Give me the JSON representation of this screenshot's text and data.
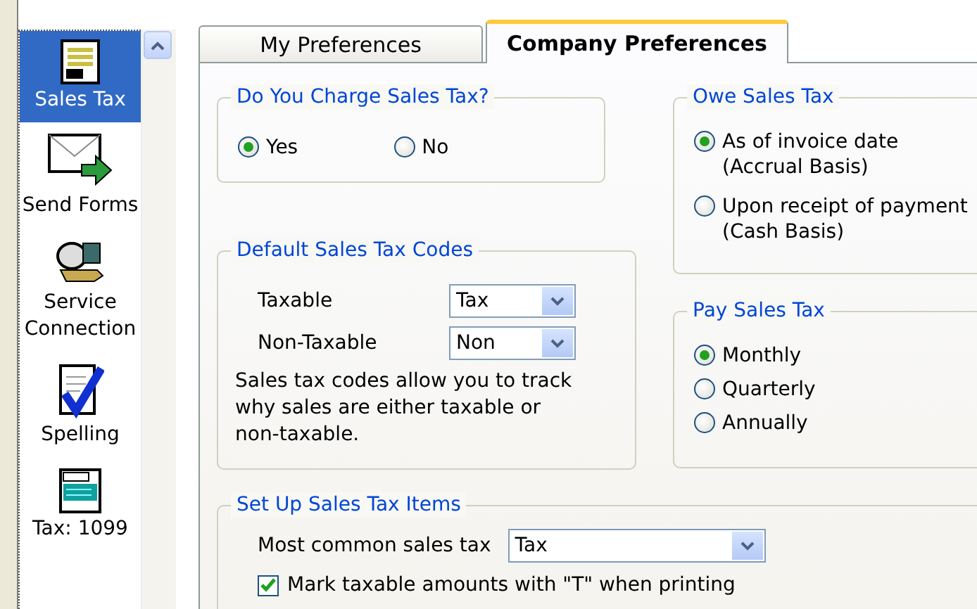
{
  "sidebar": {
    "items": [
      {
        "label": "Sales Tax",
        "selected": true
      },
      {
        "label": "Send Forms",
        "selected": false
      },
      {
        "label": "Service Connection",
        "selected": false
      },
      {
        "label": "Spelling",
        "selected": false
      },
      {
        "label": "Tax: 1099",
        "selected": false
      }
    ]
  },
  "tabs": [
    {
      "label": "My Preferences",
      "selected": false
    },
    {
      "label": "Company Preferences",
      "selected": true
    }
  ],
  "charge_sales_tax": {
    "title": "Do You Charge Sales Tax?",
    "options": [
      {
        "label": "Yes",
        "selected": true
      },
      {
        "label": "No",
        "selected": false
      }
    ]
  },
  "default_codes": {
    "title": "Default Sales Tax Codes",
    "fields": [
      {
        "label": "Taxable",
        "value": "Tax"
      },
      {
        "label": "Non-Taxable",
        "value": "Non"
      }
    ],
    "note": "Sales tax codes allow you to track why sales are either taxable or non-taxable."
  },
  "owe_sales_tax": {
    "title": "Owe Sales Tax",
    "options": [
      {
        "label": "As of invoice date",
        "sublabel": "(Accrual Basis)",
        "selected": true
      },
      {
        "label": "Upon receipt of payment",
        "sublabel": "(Cash Basis)",
        "selected": false
      }
    ]
  },
  "pay_sales_tax": {
    "title": "Pay Sales Tax",
    "options": [
      {
        "label": "Monthly",
        "selected": true
      },
      {
        "label": "Quarterly",
        "selected": false
      },
      {
        "label": "Annually",
        "selected": false
      }
    ]
  },
  "setup_items": {
    "title": "Set Up Sales Tax Items",
    "field": {
      "label": "Most common sales tax",
      "value": "Tax"
    },
    "checkbox": {
      "label": "Mark taxable amounts with \"T\" when printing",
      "checked": true
    }
  }
}
